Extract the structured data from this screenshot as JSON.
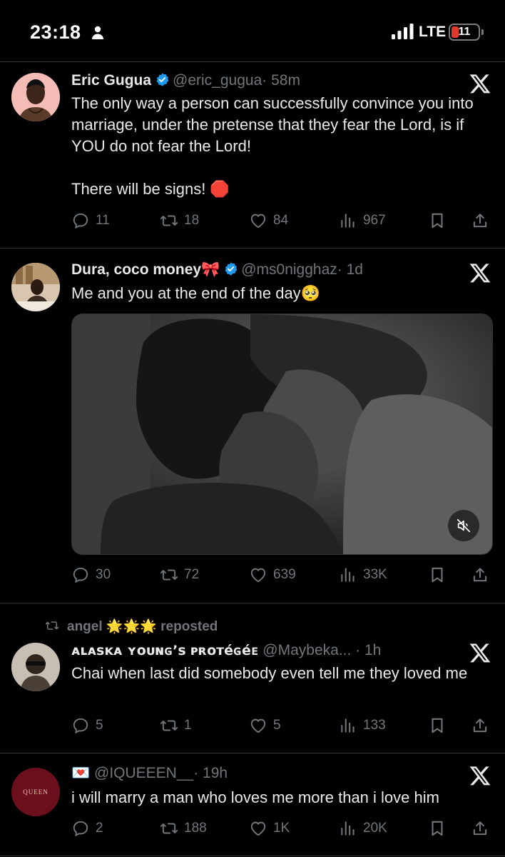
{
  "status_bar": {
    "time": "23:18",
    "network": "LTE",
    "battery": "11"
  },
  "tweets": [
    {
      "name": "Eric Gugua",
      "handle": "@eric_gugua",
      "time": "· 58m",
      "text": [
        "The only way a person can successfully convince you into marriage, under the pretense that they fear the Lord, is if YOU do not fear the Lord!",
        "There will be signs! 🛑"
      ],
      "replies": "11",
      "reposts": "18",
      "likes": "84",
      "views": "967"
    },
    {
      "name": "Dura, coco money🎀",
      "handle": "@ms0nigghaz",
      "time": "· 1d",
      "text": [
        "Me and you at the end of the day🥺"
      ],
      "replies": "30",
      "reposts": "72",
      "likes": "639",
      "views": "33K"
    },
    {
      "reposted_by": "angel 🌟🌟🌟 reposted",
      "name": "ᴀʟᴀsᴋᴀ ʏᴏᴜɴɢ’s ᴘʀᴏᴛéɢéᴇ",
      "handle": "@Maybeka... ",
      "time": "· 1h",
      "text": [
        "Chai when last did somebody even tell me they loved me"
      ],
      "replies": "5",
      "reposts": "1",
      "likes": "5",
      "views": "133"
    },
    {
      "name": "💌",
      "handle": "@IQUEEEN__",
      "time": "· 19h",
      "avatar_text": "QUEEN",
      "text": [
        "i will marry a man who loves me more than i love him"
      ],
      "replies": "2",
      "reposts": "188",
      "likes": "1K",
      "views": "20K"
    }
  ],
  "colors": {
    "background": "#000000",
    "text": "#e7e9ea",
    "muted": "#71767b",
    "verified": "#1d9bf0",
    "divider": "#2f3336"
  }
}
